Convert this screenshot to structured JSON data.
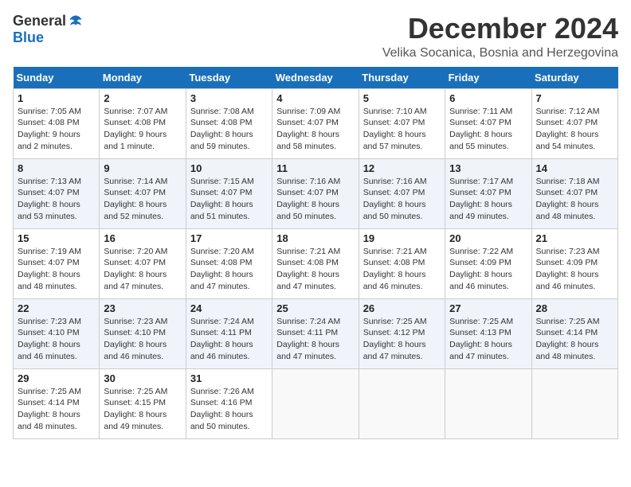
{
  "logo": {
    "general": "General",
    "blue": "Blue"
  },
  "title": "December 2024",
  "location": "Velika Socanica, Bosnia and Herzegovina",
  "days_of_week": [
    "Sunday",
    "Monday",
    "Tuesday",
    "Wednesday",
    "Thursday",
    "Friday",
    "Saturday"
  ],
  "weeks": [
    [
      {
        "day": "1",
        "info": "Sunrise: 7:05 AM\nSunset: 4:08 PM\nDaylight: 9 hours\nand 2 minutes."
      },
      {
        "day": "2",
        "info": "Sunrise: 7:07 AM\nSunset: 4:08 PM\nDaylight: 9 hours\nand 1 minute."
      },
      {
        "day": "3",
        "info": "Sunrise: 7:08 AM\nSunset: 4:08 PM\nDaylight: 8 hours\nand 59 minutes."
      },
      {
        "day": "4",
        "info": "Sunrise: 7:09 AM\nSunset: 4:07 PM\nDaylight: 8 hours\nand 58 minutes."
      },
      {
        "day": "5",
        "info": "Sunrise: 7:10 AM\nSunset: 4:07 PM\nDaylight: 8 hours\nand 57 minutes."
      },
      {
        "day": "6",
        "info": "Sunrise: 7:11 AM\nSunset: 4:07 PM\nDaylight: 8 hours\nand 55 minutes."
      },
      {
        "day": "7",
        "info": "Sunrise: 7:12 AM\nSunset: 4:07 PM\nDaylight: 8 hours\nand 54 minutes."
      }
    ],
    [
      {
        "day": "8",
        "info": "Sunrise: 7:13 AM\nSunset: 4:07 PM\nDaylight: 8 hours\nand 53 minutes."
      },
      {
        "day": "9",
        "info": "Sunrise: 7:14 AM\nSunset: 4:07 PM\nDaylight: 8 hours\nand 52 minutes."
      },
      {
        "day": "10",
        "info": "Sunrise: 7:15 AM\nSunset: 4:07 PM\nDaylight: 8 hours\nand 51 minutes."
      },
      {
        "day": "11",
        "info": "Sunrise: 7:16 AM\nSunset: 4:07 PM\nDaylight: 8 hours\nand 50 minutes."
      },
      {
        "day": "12",
        "info": "Sunrise: 7:16 AM\nSunset: 4:07 PM\nDaylight: 8 hours\nand 50 minutes."
      },
      {
        "day": "13",
        "info": "Sunrise: 7:17 AM\nSunset: 4:07 PM\nDaylight: 8 hours\nand 49 minutes."
      },
      {
        "day": "14",
        "info": "Sunrise: 7:18 AM\nSunset: 4:07 PM\nDaylight: 8 hours\nand 48 minutes."
      }
    ],
    [
      {
        "day": "15",
        "info": "Sunrise: 7:19 AM\nSunset: 4:07 PM\nDaylight: 8 hours\nand 48 minutes."
      },
      {
        "day": "16",
        "info": "Sunrise: 7:20 AM\nSunset: 4:07 PM\nDaylight: 8 hours\nand 47 minutes."
      },
      {
        "day": "17",
        "info": "Sunrise: 7:20 AM\nSunset: 4:08 PM\nDaylight: 8 hours\nand 47 minutes."
      },
      {
        "day": "18",
        "info": "Sunrise: 7:21 AM\nSunset: 4:08 PM\nDaylight: 8 hours\nand 47 minutes."
      },
      {
        "day": "19",
        "info": "Sunrise: 7:21 AM\nSunset: 4:08 PM\nDaylight: 8 hours\nand 46 minutes."
      },
      {
        "day": "20",
        "info": "Sunrise: 7:22 AM\nSunset: 4:09 PM\nDaylight: 8 hours\nand 46 minutes."
      },
      {
        "day": "21",
        "info": "Sunrise: 7:23 AM\nSunset: 4:09 PM\nDaylight: 8 hours\nand 46 minutes."
      }
    ],
    [
      {
        "day": "22",
        "info": "Sunrise: 7:23 AM\nSunset: 4:10 PM\nDaylight: 8 hours\nand 46 minutes."
      },
      {
        "day": "23",
        "info": "Sunrise: 7:23 AM\nSunset: 4:10 PM\nDaylight: 8 hours\nand 46 minutes."
      },
      {
        "day": "24",
        "info": "Sunrise: 7:24 AM\nSunset: 4:11 PM\nDaylight: 8 hours\nand 46 minutes."
      },
      {
        "day": "25",
        "info": "Sunrise: 7:24 AM\nSunset: 4:11 PM\nDaylight: 8 hours\nand 47 minutes."
      },
      {
        "day": "26",
        "info": "Sunrise: 7:25 AM\nSunset: 4:12 PM\nDaylight: 8 hours\nand 47 minutes."
      },
      {
        "day": "27",
        "info": "Sunrise: 7:25 AM\nSunset: 4:13 PM\nDaylight: 8 hours\nand 47 minutes."
      },
      {
        "day": "28",
        "info": "Sunrise: 7:25 AM\nSunset: 4:14 PM\nDaylight: 8 hours\nand 48 minutes."
      }
    ],
    [
      {
        "day": "29",
        "info": "Sunrise: 7:25 AM\nSunset: 4:14 PM\nDaylight: 8 hours\nand 48 minutes."
      },
      {
        "day": "30",
        "info": "Sunrise: 7:25 AM\nSunset: 4:15 PM\nDaylight: 8 hours\nand 49 minutes."
      },
      {
        "day": "31",
        "info": "Sunrise: 7:26 AM\nSunset: 4:16 PM\nDaylight: 8 hours\nand 50 minutes."
      },
      {
        "day": "",
        "info": ""
      },
      {
        "day": "",
        "info": ""
      },
      {
        "day": "",
        "info": ""
      },
      {
        "day": "",
        "info": ""
      }
    ]
  ]
}
